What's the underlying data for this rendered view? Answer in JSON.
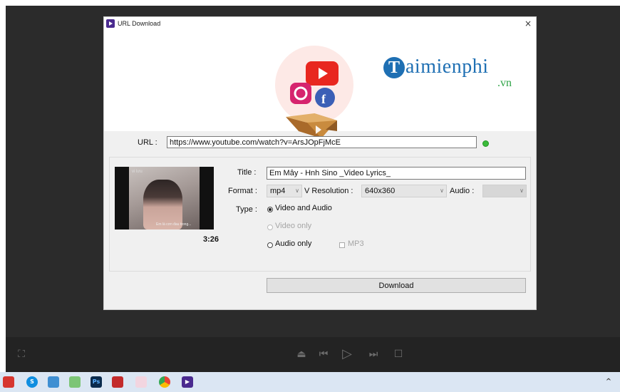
{
  "dialog": {
    "title": "URL Download",
    "close_label": "×"
  },
  "brand": {
    "initial": "T",
    "name": "aimienphi",
    "tld": ".vn"
  },
  "url": {
    "label": "URL :",
    "value": "https://www.youtube.com/watch?v=ArsJOpFjMcE"
  },
  "video": {
    "duration": "3:26",
    "thumb_caption_top": "vi lưu",
    "thumb_caption_bottom": "Em là cơn đau trong..."
  },
  "fields": {
    "title_label": "Title :",
    "title_value": "Em Mây - Hnh Sino _Video Lyrics_",
    "format_label": "Format :",
    "format_value": "mp4",
    "resolution_label": "V Resolution :",
    "resolution_value": "640x360",
    "audio_label": "Audio :",
    "audio_value": "",
    "type_label": "Type :"
  },
  "type_options": {
    "video_audio": "Video and Audio",
    "video_only": "Video only",
    "audio_only": "Audio only",
    "mp3": "MP3"
  },
  "download_label": "Download",
  "player": {
    "icons": [
      "expand-icon",
      "eject-icon",
      "previous-icon",
      "play-icon",
      "next-icon",
      "stop-icon"
    ]
  },
  "taskbar": {
    "icons": [
      "app-red-icon",
      "skype-icon",
      "app-blue-icon",
      "notepad-icon",
      "photoshop-icon",
      "calendar-icon",
      "app-flower-icon",
      "chrome-icon",
      "media-app-icon"
    ],
    "tray_chevron": "^"
  },
  "colors": {
    "brand_blue": "#1e6fb3",
    "brand_green": "#2da345",
    "status_green": "#3bbb3b",
    "dark_bg": "#2b2b2b"
  }
}
